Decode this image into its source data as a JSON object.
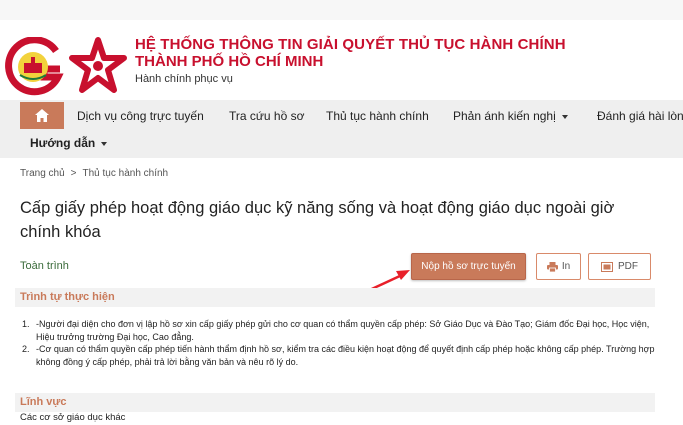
{
  "header": {
    "title_line1": "HỆ THỐNG THÔNG TIN GIẢI QUYẾT THỦ TỤC HÀNH CHÍNH",
    "title_line2": "THÀNH PHỐ HỒ CHÍ MINH",
    "subtitle": "Hành chính phục vụ",
    "logo_left": "hcmc-emblem-logo",
    "logo_right": "star-logo"
  },
  "nav": {
    "home_icon": "home-icon",
    "items": [
      {
        "label": "Dịch vụ công trực tuyến"
      },
      {
        "label": "Tra cứu hồ sơ"
      },
      {
        "label": "Thủ tục hành chính"
      },
      {
        "label": "Phản ánh kiến nghị"
      },
      {
        "label": "Đánh giá hài lòng"
      },
      {
        "label": "Hướng dẫn"
      }
    ]
  },
  "breadcrumb": {
    "home": "Trang chủ",
    "separator": ">",
    "current": "Thủ tục hành chính"
  },
  "page": {
    "title": "Cấp giấy phép hoạt động giáo dục kỹ năng sống và hoạt động giáo dục ngoài giờ chính khóa",
    "toan_trinh": "Toàn trình"
  },
  "actions": {
    "submit_label": "Nộp hồ sơ trực tuyến",
    "print_label": "In",
    "pdf_label": "PDF"
  },
  "sections": {
    "procedure_title": "Trình tự thực hiện",
    "steps": [
      {
        "num": "1.",
        "text": "-Người đại diện cho đơn vị lập hồ sơ xin cấp giấy phép gửi cho cơ quan có thẩm quyền cấp phép: Sở Giáo Dục và Đào Tạo; Giám đốc Đại học, Học viện, Hiệu trưởng trường Đại học, Cao đẳng."
      },
      {
        "num": "2.",
        "text": "-Cơ quan có thẩm quyền cấp phép tiến hành thẩm định hồ sơ, kiểm tra các điều kiện hoạt động để quyết định cấp phép hoặc không cấp phép. Trường hợp không đồng ý cấp phép, phải trả lời bằng văn bản và nêu rõ lý do."
      }
    ],
    "field_title": "Lĩnh vực",
    "field_value": "Các cơ sở giáo dục khác"
  },
  "colors": {
    "brand_red": "#c8102e",
    "accent": "#c97a5a",
    "arrow_red": "#e8202a"
  }
}
